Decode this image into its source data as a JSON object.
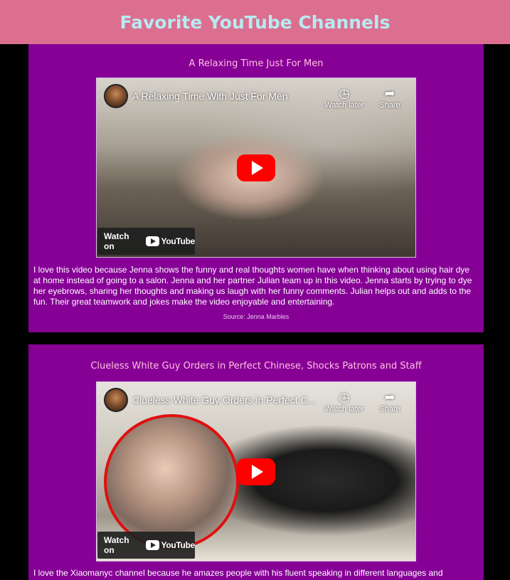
{
  "header": {
    "title": "Favorite YouTube Channels"
  },
  "cards": [
    {
      "title": "A Relaxing Time Just For Men",
      "video_title": "A Relaxing Time With Just For Men",
      "watch_later_label": "Watch later",
      "share_label": "Share",
      "watch_on_label": "Watch on",
      "youtube_label": "YouTube",
      "description": "I love this video because Jenna shows the funny and real thoughts women have when thinking about using hair dye at home instead of going to a salon. Jenna and her partner Julian team up in this video. Jenna starts by trying to dye her eyebrows, sharing her thoughts and making us laugh with her funny comments. Julian helps out and adds to the fun. Their great teamwork and jokes make the video enjoyable and entertaining.",
      "source": "Source: Jenna Marbles"
    },
    {
      "title": "Clueless White Guy Orders in Perfect Chinese, Shocks Patrons and Staff",
      "video_title": "Clueless White Guy Orders in Perfect C...",
      "watch_later_label": "Watch later",
      "share_label": "Share",
      "watch_on_label": "Watch on",
      "youtube_label": "YouTube",
      "description": "I love the Xiaomanyc channel because he amazes people with his fluent speaking in different languages and"
    }
  ],
  "colors": {
    "header_bg": "#dc6f90",
    "header_text": "#b8eaf0",
    "card_bg": "#860096",
    "card_title": "#ffc0e0",
    "page_bg": "#000000",
    "play_button": "#ff0000"
  },
  "icons": [
    "clock-icon",
    "share-icon",
    "play-icon",
    "youtube-logo-icon"
  ]
}
